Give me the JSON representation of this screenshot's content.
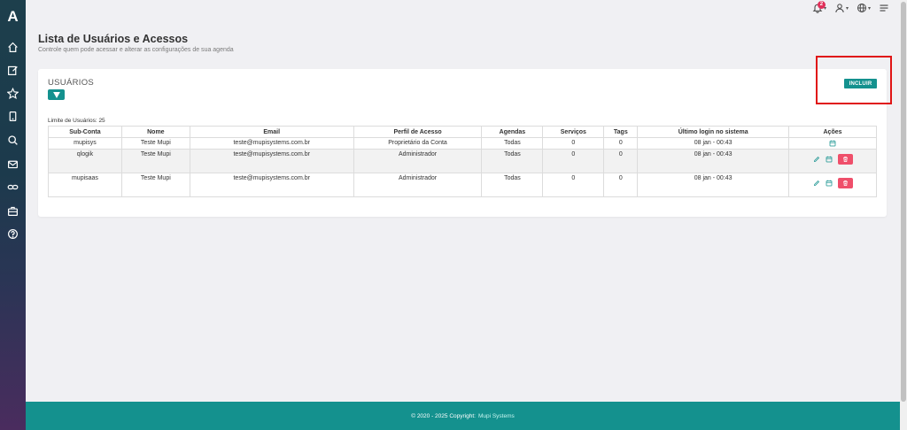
{
  "app": {
    "logo_letter": "A"
  },
  "topbar": {
    "notification_count": "2"
  },
  "page": {
    "title": "Lista de Usuários e Acessos",
    "subtitle": "Controle quem pode acessar e alterar as configurações de sua agenda"
  },
  "card": {
    "title": "USUÁRIOS",
    "incluir_label": "INCLUIR",
    "limit_text": "Limite de Usuários: 25"
  },
  "table": {
    "headers": [
      "Sub-Conta",
      "Nome",
      "Email",
      "Perfil de Acesso",
      "Agendas",
      "Serviços",
      "Tags",
      "Último login no sistema",
      "Ações"
    ],
    "rows": [
      {
        "subconta": "mupisys",
        "nome": "Teste Mupi",
        "email": "teste@mupisystems.com.br",
        "perfil": "Proprietário da Conta",
        "agendas": "Todas",
        "servicos": "0",
        "tags": "0",
        "ultimo_login": "08 jan - 00:43"
      },
      {
        "subconta": "qlogik",
        "nome": "Teste Mupi",
        "email": "teste@mupisystems.com.br",
        "perfil": "Administrador",
        "agendas": "Todas",
        "servicos": "0",
        "tags": "0",
        "ultimo_login": "08 jan - 00:43"
      },
      {
        "subconta": "mupisaas",
        "nome": "Teste Mupi",
        "email": "teste@mupisystems.com.br",
        "perfil": "Administrador",
        "agendas": "Todas",
        "servicos": "0",
        "tags": "0",
        "ultimo_login": "08 jan - 00:43"
      }
    ]
  },
  "footer": {
    "text": "© 2020 - 2025 Copyright:",
    "brand": "Mupi Systems"
  },
  "sidebar_icons": [
    "home-icon",
    "edit-icon",
    "star-icon",
    "tablet-icon",
    "search-icon",
    "mail-icon",
    "link-icon",
    "briefcase-icon",
    "help-icon"
  ],
  "colors": {
    "accent": "#14918e",
    "danger": "#ef4f6a",
    "highlight": "#e01515"
  }
}
